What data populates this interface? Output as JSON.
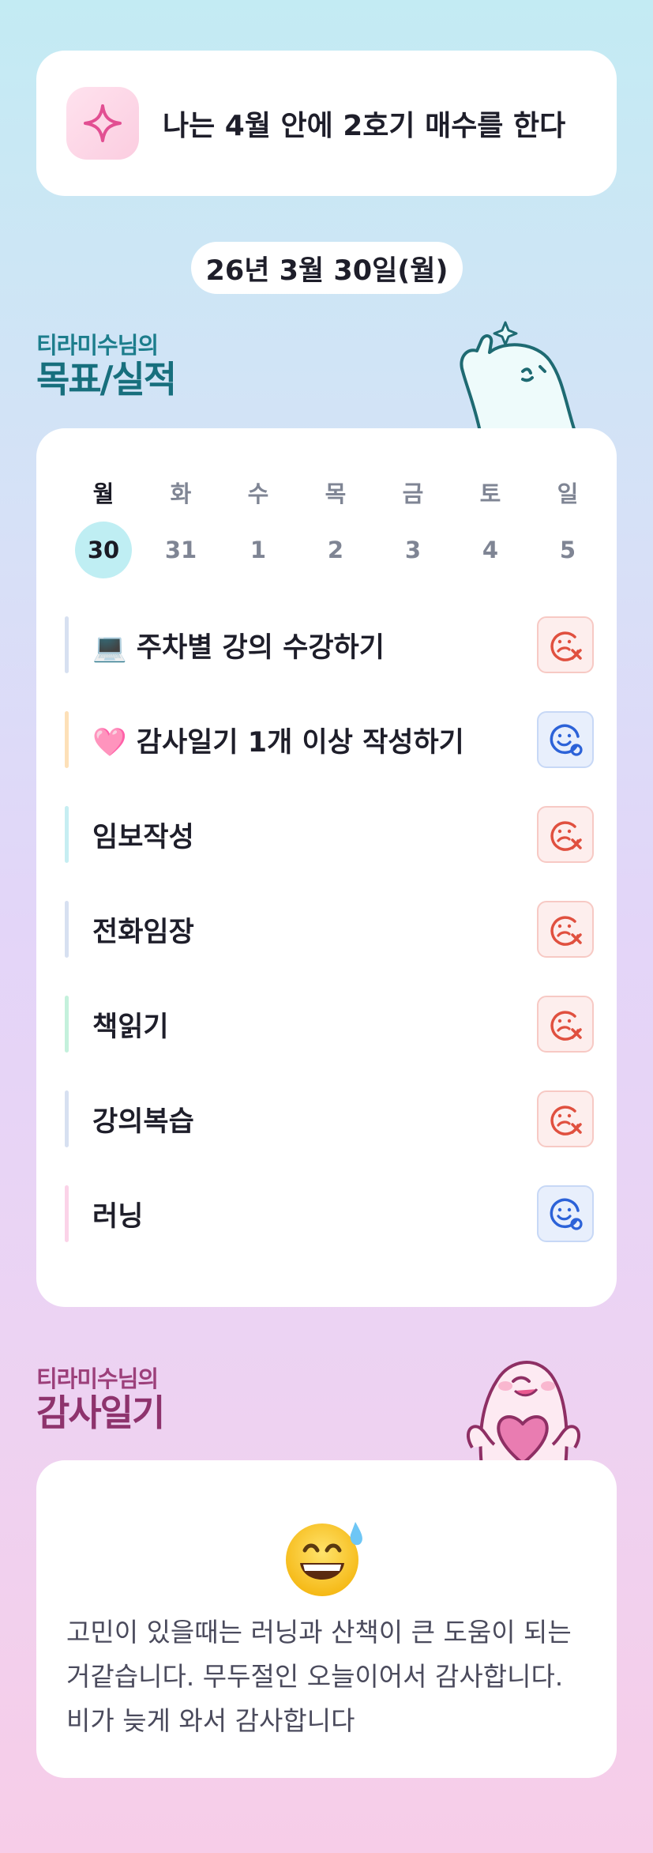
{
  "goal": {
    "text": "나는 4월 안에 2호기 매수를 한다",
    "icon": "sparkle-icon"
  },
  "date": "26년 3월 30일(월)",
  "goals_section": {
    "subtitle": "티라미수님의",
    "title": "목표/실적"
  },
  "week": {
    "days": [
      {
        "dow": "월",
        "num": "30",
        "today": true
      },
      {
        "dow": "화",
        "num": "31",
        "today": false
      },
      {
        "dow": "수",
        "num": "1",
        "today": false
      },
      {
        "dow": "목",
        "num": "2",
        "today": false
      },
      {
        "dow": "금",
        "num": "3",
        "today": false
      },
      {
        "dow": "토",
        "num": "4",
        "today": false
      },
      {
        "dow": "일",
        "num": "5",
        "today": false
      }
    ]
  },
  "habits": [
    {
      "label": "💻 주차별 강의 수강하기",
      "bar_color": "#d7e0f1",
      "status": "fail"
    },
    {
      "label": "🩷 감사일기 1개 이상 작성하기",
      "bar_color": "#fde0b8",
      "status": "done"
    },
    {
      "label": "임보작성",
      "bar_color": "#c6eef2",
      "status": "fail"
    },
    {
      "label": "전화임장",
      "bar_color": "#d7e0f1",
      "status": "fail"
    },
    {
      "label": "책읽기",
      "bar_color": "#c4f1dc",
      "status": "fail"
    },
    {
      "label": "강의복습",
      "bar_color": "#d7e0f1",
      "status": "fail"
    },
    {
      "label": "러닝",
      "bar_color": "#fbd3e8",
      "status": "done"
    }
  ],
  "status_icons": {
    "fail": "sad-face-x-icon",
    "done": "smile-face-check-icon"
  },
  "gratitude_section": {
    "subtitle": "티라미수님의",
    "title": "감사일기"
  },
  "gratitude": {
    "emoji": "grinning-sweat-emoji",
    "text": "고민이 있을때는 러닝과 산책이 큰 도움이 되는거같습니다. 무두절인 오늘이어서 감사합니다. 비가 늦게 와서 감사합니다"
  },
  "colors": {
    "fail": "#e0503f",
    "done": "#2c62d8",
    "today": "#bfeef3"
  }
}
